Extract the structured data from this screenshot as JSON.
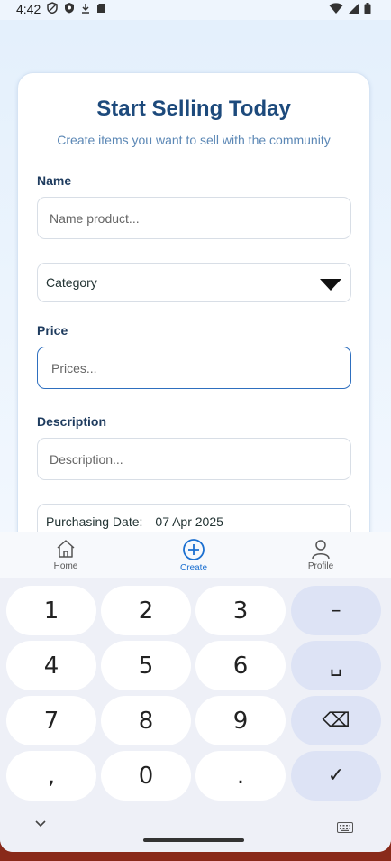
{
  "status_bar": {
    "time": "4:42",
    "left_icons": [
      "shield-icon",
      "shield-filled-icon",
      "download-icon",
      "sd-card-icon"
    ],
    "right_icons": [
      "wifi-icon",
      "signal-icon",
      "battery-icon"
    ]
  },
  "form": {
    "title": "Start Selling Today",
    "subtitle": "Create items you want to sell with the community",
    "name_label": "Name",
    "name_placeholder": "Name product...",
    "category_value": "Category",
    "price_label": "Price",
    "price_placeholder": "Prices...",
    "description_label": "Description",
    "description_placeholder": "Description...",
    "date_label": "Purchasing Date:",
    "date_value": "07 Apr 2025"
  },
  "bottom_nav": {
    "items": [
      {
        "label": "Home",
        "icon": "home-icon",
        "active": false
      },
      {
        "label": "Create",
        "icon": "plus-circle-icon",
        "active": true
      },
      {
        "label": "Profile",
        "icon": "profile-icon",
        "active": false
      }
    ]
  },
  "keyboard": {
    "keys": [
      [
        "1",
        "2",
        "3",
        "–"
      ],
      [
        "4",
        "5",
        "6",
        "␣"
      ],
      [
        "7",
        "8",
        "9",
        "⌫"
      ],
      [
        ",",
        "0",
        ".",
        "✓"
      ]
    ],
    "accent_color": "#dde3f5"
  },
  "colors": {
    "title": "#1d4a7c",
    "subtitle": "#5b87b5",
    "active_nav": "#1a6fd0",
    "focus_border": "#2e6fbf"
  }
}
